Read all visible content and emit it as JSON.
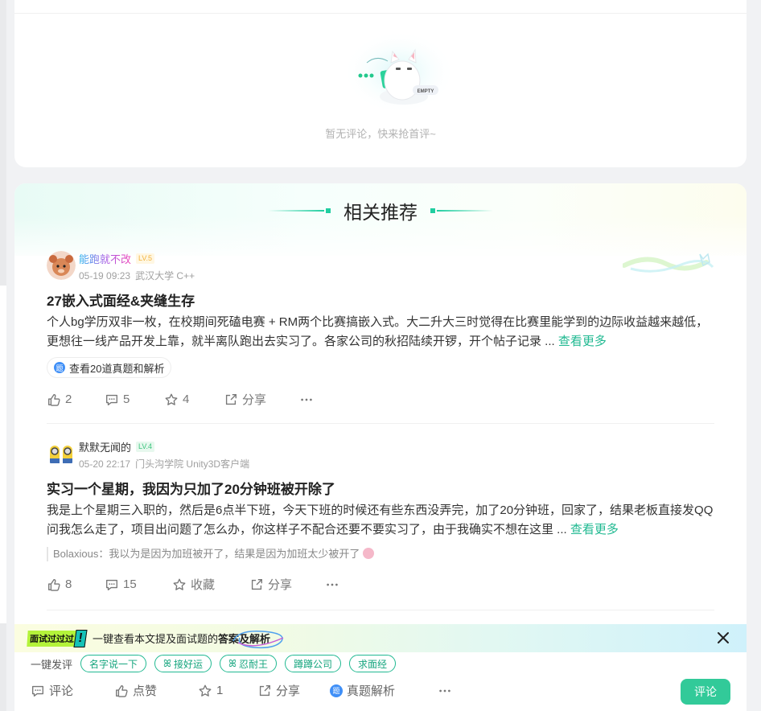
{
  "empty": {
    "badge": "EMPTY",
    "text": "暂无评论，快来抢首评~"
  },
  "related": {
    "title": "相关推荐"
  },
  "posts": [
    {
      "user": "能跑就不改",
      "level": "LV.5",
      "time": "05-19 09:23",
      "school": "武汉大学 C++",
      "title": "27嵌入式面经&夹缝生存",
      "body": "个人bg学历双非一枚，在校期间死磕电赛 + RM两个比赛搞嵌入式。大二升大三时觉得在比赛里能学到的边际收益越来越低，更想往一线产品开发上靠，就半离队跑出去实习了。各家公司的秋招陆续开锣，开个帖子记录 ...",
      "more": "查看更多",
      "chip_icon": "题",
      "chip": "查看20道真题和解析",
      "likes": "2",
      "comments": "5",
      "favs": "4",
      "share": "分享"
    },
    {
      "user": "默默无闻的",
      "level": "LV.4",
      "time": "05-20 22:17",
      "school": "门头沟学院 Unity3D客户端",
      "title": "实习一个星期，我因为只加了20分钟班被开除了",
      "body": "我是上个星期三入职的，然后是6点半下班，今天下班的时候还有些东西没弄完，加了20分钟班，回家了，结果老板直接发QQ问我怎么走了，项目出问题了怎么办，你这样子不配合还要不要实习了，由于我确实不想在这里 ...",
      "more": "查看更多",
      "quote": "Bolaxious：我以为是因为加班被开了，结果是因为加班太少被开了",
      "likes": "8",
      "comments": "15",
      "favs": "收藏",
      "share": "分享"
    }
  ],
  "promo": {
    "badge": "面试过过过",
    "excl": "!",
    "text": "一键查看本文提及面试题的",
    "highlight": "答案及解析"
  },
  "quick": {
    "label": "一键发评",
    "tags": [
      "名字说一下",
      "接好运",
      "忍耐王",
      "蹲蹲公司",
      "求面经"
    ],
    "tag_icon": "ꕤ"
  },
  "bar": {
    "comment": "评论",
    "like": "点赞",
    "fav": "1",
    "share": "分享",
    "analysis_icon": "题",
    "analysis": "真题解析",
    "submit": "评论"
  },
  "colors": {
    "accent": "#20b991",
    "button": "#32ca99",
    "lv5": "#f2b33d",
    "lv4": "#3bc47d"
  },
  "icons": [
    "thumb-up-icon",
    "comment-icon",
    "star-icon",
    "share-icon",
    "more-icon",
    "close-icon"
  ]
}
